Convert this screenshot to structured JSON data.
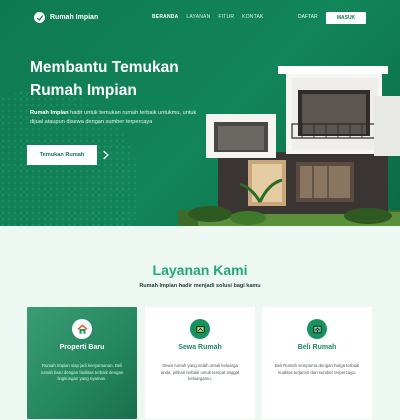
{
  "brand": {
    "name": "Rumah Impian",
    "primary": "#12855a",
    "accent": "#23a877"
  },
  "nav": {
    "items": [
      {
        "label": "BERANDA",
        "active": true
      },
      {
        "label": "LAYANAN",
        "active": false
      },
      {
        "label": "FITUR",
        "active": false
      },
      {
        "label": "KONTAK",
        "active": false
      }
    ],
    "register_label": "DAFTAR",
    "login_label": "MASUK"
  },
  "hero": {
    "title_line1": "Membantu Temukan",
    "title_line2": "Rumah Impian",
    "desc_brand": "Rumah Impian",
    "desc_rest": " hadir untuk temukan rumah terbaik untukmu, untuk dijual ataupun disewa dengan sumber terpercaya",
    "cta_label": "Temukan Rumah",
    "cta_icon": "chevron-right-icon"
  },
  "services": {
    "title": "Layanan Kami",
    "subtitle": "Rumah Impian hadir menjadi solusi bagi kamu",
    "cards": [
      {
        "icon": "house-icon",
        "title": "Properti Baru",
        "desc": "Rumah Impian siap jadi kenyamanan. Beli rumah baru dengan fasilitas terbaik dengan lingkungan yang nyaman."
      },
      {
        "icon": "rent-house-icon",
        "title": "Sewa Rumah",
        "desc": "Sewa rumah yang indah untuk keluarga anda, pilihan terbaik untuk tempat tinggal keluargamu."
      },
      {
        "icon": "buy-house-icon",
        "title": "Beli Rumah",
        "desc": "Beli Rumah sempurna dengan harga terbaik kualitas terjamin dan sumber terpercaya."
      }
    ]
  }
}
